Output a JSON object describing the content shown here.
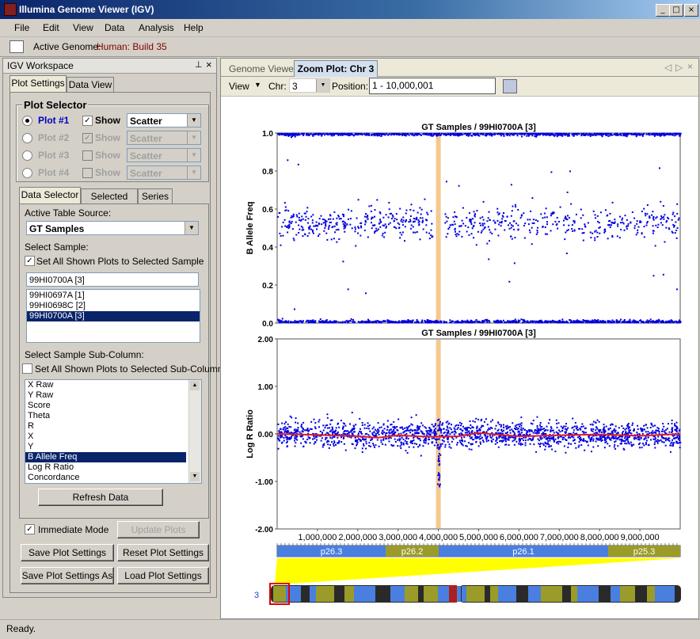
{
  "window": {
    "title": "Illumina Genome Viewer (IGV)"
  },
  "menu": [
    "File",
    "Edit",
    "View",
    "Data",
    "Analysis",
    "Help"
  ],
  "toolbar": {
    "genome_label": "Active Genome:",
    "genome_value": "Human: Build 35"
  },
  "workspace": {
    "title": "IGV Workspace",
    "pin": "⚖",
    "tabs": [
      "Plot Settings",
      "Data View"
    ],
    "plot_selector": {
      "title": "Plot Selector",
      "show_label": "Show",
      "plots": [
        {
          "name": "Plot #1",
          "type": "Scatter",
          "selected": true,
          "show": true,
          "enabled": true
        },
        {
          "name": "Plot #2",
          "type": "Scatter",
          "selected": false,
          "show": true,
          "enabled": false
        },
        {
          "name": "Plot #3",
          "type": "Scatter",
          "selected": false,
          "show": false,
          "enabled": false
        },
        {
          "name": "Plot #4",
          "type": "Scatter",
          "selected": false,
          "show": false,
          "enabled": false
        }
      ]
    },
    "sub_tabs": [
      "Data Selector",
      "Selected Plot",
      "Series"
    ],
    "active_table_label": "Active Table Source:",
    "active_table_value": "GT Samples",
    "select_sample_label": "Select Sample:",
    "set_all_sample_label": "Set All Shown Plots to Selected Sample",
    "sample_value": "99HI0700A [3]",
    "samples": [
      "99HI0697A [1]",
      "99HI0698C [2]",
      "99HI0700A [3]"
    ],
    "selected_sample_index": 2,
    "subcolumn_label": "Select Sample Sub-Column:",
    "set_all_sub_label": "Set All Shown Plots to Selected Sub-Column",
    "subcolumns": [
      "X Raw",
      "Y Raw",
      "Score",
      "Theta",
      "R",
      "X",
      "Y",
      "B Allele Freq",
      "Log R Ratio",
      "Concordance"
    ],
    "selected_subcolumn_index": 7,
    "refresh": "Refresh Data",
    "immediate_mode": "Immediate Mode",
    "update_plots": "Update Plots",
    "save_settings": "Save Plot Settings",
    "reset_settings": "Reset Plot Settings",
    "save_as": "Save Plot Settings As",
    "load_settings": "Load Plot Settings"
  },
  "viewer": {
    "tabs": [
      "Genome Viewer",
      "Zoom Plot: Chr 3"
    ],
    "view_label": "View",
    "chr_label": "Chr:",
    "chr_value": "3",
    "position_label": "Position:",
    "position_value": "1 - 10,000,001"
  },
  "chart_data": [
    {
      "type": "scatter",
      "title": "GT Samples / 99HI0700A [3]",
      "ylabel": "B Allele Freq",
      "ylim": [
        0,
        1
      ],
      "yticks": [
        "0.0",
        "0.2",
        "0.4",
        "0.6",
        "0.8",
        "1.0"
      ],
      "xlim": [
        0,
        10000001
      ],
      "highlight_x": 4000000,
      "series": [
        {
          "band_centers": [
            0,
            0.5,
            1.0
          ],
          "color": "#0000e0"
        }
      ]
    },
    {
      "type": "scatter",
      "title": "GT Samples / 99HI0700A [3]",
      "ylabel": "Log R Ratio",
      "ylim": [
        -2,
        2
      ],
      "yticks": [
        "-2.00",
        "-1.00",
        "0.00",
        "1.00",
        "2.00"
      ],
      "xlim": [
        0,
        10000001
      ],
      "xticks": [
        "1,000,000",
        "2,000,000",
        "3,000,000",
        "4,000,000",
        "5,000,000",
        "6,000,000",
        "7,000,000",
        "8,000,000",
        "9,000,000"
      ],
      "highlight_x": 4000000,
      "series": [
        {
          "center": 0,
          "color": "#0000e0"
        },
        {
          "name": "",
          "color": "#e02020",
          "type": "line",
          "x": [
            0,
            1000000,
            2000000,
            2500000,
            3000000,
            3500000,
            4000000,
            4500000,
            5000000,
            6000000,
            7000000,
            8000000,
            9000000,
            10000000
          ],
          "y": [
            0.0,
            -0.02,
            -0.05,
            -0.08,
            -0.03,
            -0.05,
            -0.06,
            -0.05,
            0.02,
            -0.05,
            -0.03,
            -0.01,
            -0.04,
            0.0
          ]
        }
      ]
    }
  ],
  "bands": [
    {
      "name": "p26.3",
      "color": "#4a7fe0"
    },
    {
      "name": "p26.2",
      "color": "#9b9b2a"
    },
    {
      "name": "p26.1",
      "color": "#4a7fe0"
    },
    {
      "name": "p25.3",
      "color": "#9b9b2a"
    }
  ],
  "chromosome_label": "3",
  "status": "Ready."
}
